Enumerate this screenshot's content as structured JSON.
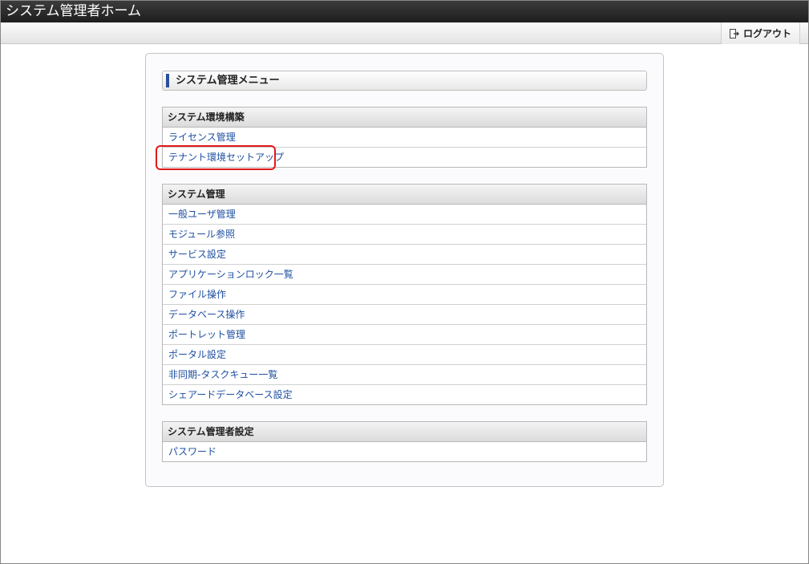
{
  "window": {
    "title": "システム管理者ホーム"
  },
  "toolbar": {
    "logout_label": "ログアウト"
  },
  "menu": {
    "title": "システム管理メニュー"
  },
  "sections": [
    {
      "header": "システム環境構築",
      "items": [
        "ライセンス管理",
        "テナント環境セットアップ"
      ]
    },
    {
      "header": "システム管理",
      "items": [
        "一般ユーザ管理",
        "モジュール参照",
        "サービス設定",
        "アプリケーションロック一覧",
        "ファイル操作",
        "データベース操作",
        "ポートレット管理",
        "ポータル設定",
        "非同期-タスクキュー一覧",
        "シェアードデータベース設定"
      ]
    },
    {
      "header": "システム管理者設定",
      "items": [
        "パスワード"
      ]
    }
  ],
  "icons": {
    "logout": "logout-icon"
  },
  "colors": {
    "link": "#1d4fa0",
    "accent": "#2a4f9a",
    "highlight": "#e01818"
  }
}
